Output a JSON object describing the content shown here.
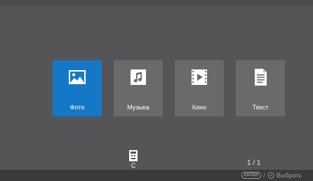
{
  "menu": {
    "tiles": [
      {
        "label": "Фото",
        "icon": "photo-icon",
        "selected": true
      },
      {
        "label": "Музыка",
        "icon": "music-icon",
        "selected": false
      },
      {
        "label": "Кино",
        "icon": "film-icon",
        "selected": false
      },
      {
        "label": "Текст",
        "icon": "text-document-icon",
        "selected": false
      }
    ]
  },
  "drive": {
    "label": "C",
    "icon": "usb-drive-icon"
  },
  "pagination": {
    "counter": "1 / 1"
  },
  "hint": {
    "enter_key": "ENTER",
    "separator": "/",
    "select_label": "Выбрать",
    "circle_icon": "ok-button-icon"
  },
  "colors": {
    "background": "#555557",
    "tile": "#6a6a6a",
    "tile_selected": "#1578c6",
    "bottom_bar": "#3a3a3c"
  }
}
